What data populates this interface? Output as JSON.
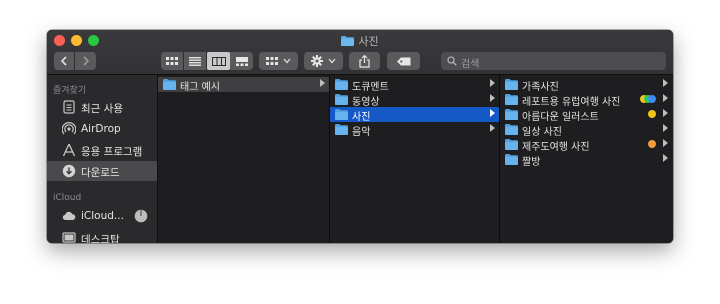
{
  "window": {
    "title": "사진"
  },
  "toolbar": {
    "back_icon": "chevron-left-icon",
    "forward_icon": "chevron-right-icon",
    "view_icons": [
      "icon-view-icon",
      "list-view-icon",
      "column-view-icon",
      "gallery-view-icon"
    ],
    "group_icon": "group-grid-icon",
    "action_icon": "gear-icon",
    "share_icon": "share-icon",
    "tag_icon": "tag-icon",
    "search_placeholder": "검색"
  },
  "sidebar": {
    "favorites_header": "즐겨찾기",
    "favorites": [
      {
        "label": "최근 사용",
        "icon": "recent-icon"
      },
      {
        "label": "AirDrop",
        "icon": "airdrop-icon"
      },
      {
        "label": "응용 프로그램",
        "icon": "applications-icon"
      },
      {
        "label": "다운로드",
        "icon": "download-icon",
        "selected": true
      }
    ],
    "icloud_header": "iCloud",
    "icloud": [
      {
        "label": "iCloud...",
        "icon": "cloud-icon"
      },
      {
        "label": "데스크탑",
        "icon": "desktop-icon"
      }
    ]
  },
  "columns": {
    "col1": [
      {
        "label": "태그 예시"
      }
    ],
    "col2": [
      {
        "label": "도큐멘트"
      },
      {
        "label": "동영상"
      },
      {
        "label": "사진"
      },
      {
        "label": "음악"
      }
    ],
    "col3": [
      {
        "label": "가족사진",
        "tags": []
      },
      {
        "label": "레포트용 유럽여행 사진",
        "tags": [
          "#f0c419",
          "#34c759",
          "#3a8ef6"
        ]
      },
      {
        "label": "아름다운 일러스트",
        "tags": [
          "#f0c419"
        ]
      },
      {
        "label": "일상 사진",
        "tags": []
      },
      {
        "label": "제주도여행 사진",
        "tags": [
          "#f39c3c"
        ]
      },
      {
        "label": "짤방",
        "tags": []
      }
    ]
  },
  "colors": {
    "selection_blue": "#1559c7",
    "folder_blue": "#56a8e6"
  }
}
